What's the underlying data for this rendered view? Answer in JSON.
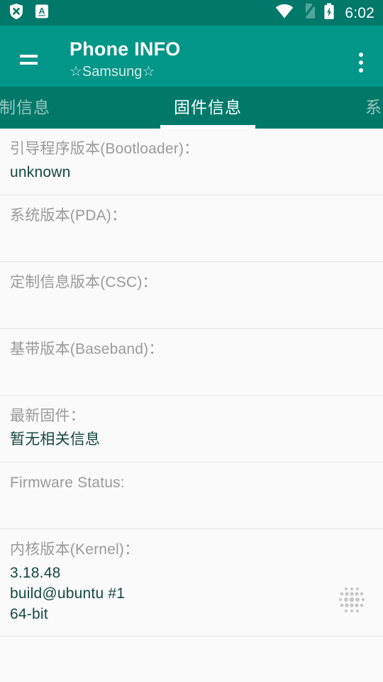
{
  "status_bar": {
    "icons_left": [
      "shield-x-icon",
      "letter-a-badge-icon"
    ],
    "icons_right": [
      "wifi-icon",
      "no-sim-icon",
      "battery-charging-icon"
    ],
    "clock": "6:02",
    "background_color": "#00796b"
  },
  "app_bar": {
    "nav_icon": "hamburger-menu-icon",
    "title": "Phone INFO",
    "subtitle": "☆Samsung☆",
    "overflow_icon": "overflow-menu-icon",
    "background_color": "#009688"
  },
  "tabs": {
    "background_color": "#00796b",
    "active_index": 1,
    "items": [
      {
        "label": "定制信息"
      },
      {
        "label": "固件信息"
      },
      {
        "label": "系统信息"
      }
    ]
  },
  "list": {
    "label_color": "#9a9a9a",
    "value_color": "#15493d",
    "rows": [
      {
        "label": "引导程序版本(Bootloader)：",
        "value": "unknown"
      },
      {
        "label": "系统版本(PDA)：",
        "value": ""
      },
      {
        "label": "定制信息版本(CSC)：",
        "value": ""
      },
      {
        "label": "基带版本(Baseband)：",
        "value": ""
      },
      {
        "label": "最新固件：",
        "value": "暂无相关信息"
      },
      {
        "label": "Firmware Status:",
        "value": ""
      },
      {
        "label": "内核版本(Kernel)：",
        "value": "3.18.48\nbuild@ubuntu #1\n64-bit",
        "decoration": "dot-grid-icon"
      }
    ]
  }
}
